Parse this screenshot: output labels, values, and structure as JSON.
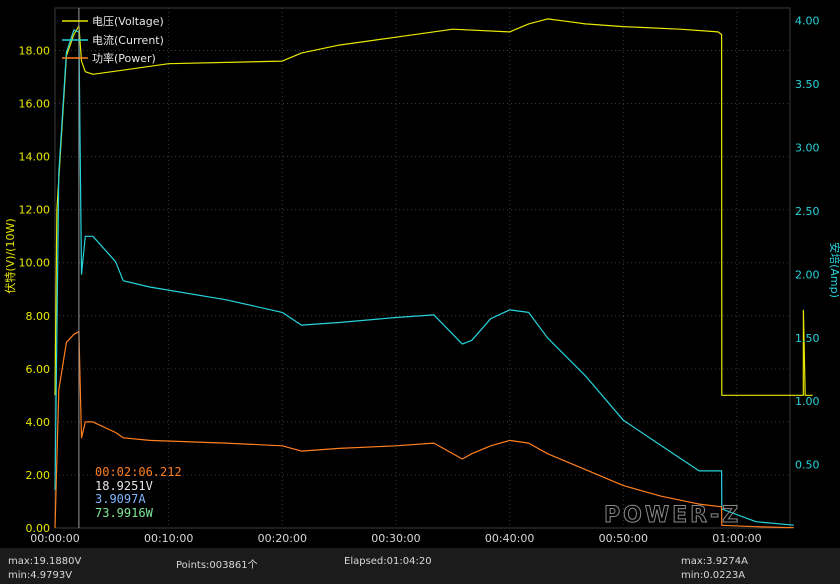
{
  "chart_data": {
    "type": "line",
    "left_axis": {
      "label": "伏特(V)/(10W)",
      "color": "#e8e800",
      "range": [
        0,
        19.6
      ],
      "ticks": [
        "0.00",
        "2.00",
        "4.00",
        "6.00",
        "8.00",
        "10.00",
        "12.00",
        "14.00",
        "16.00",
        "18.00"
      ]
    },
    "right_axis": {
      "label": "安培(Amp)",
      "color": "#27d3dc",
      "range": [
        0,
        4.1
      ],
      "ticks": [
        "0.50",
        "1.00",
        "1.50",
        "2.00",
        "2.50",
        "3.00",
        "3.50",
        "4.00"
      ]
    },
    "x_axis": {
      "range_seconds": [
        0,
        3880
      ],
      "ticks": [
        "00:00:00",
        "00:10:00",
        "00:20:00",
        "00:30:00",
        "00:40:00",
        "00:50:00",
        "01:00:00"
      ]
    },
    "grid": true,
    "legend": {
      "position": "top-left",
      "entries": [
        {
          "name": "电压(Voltage)",
          "color": "#e8e800"
        },
        {
          "name": "电流(Current)",
          "color": "#27d3dc"
        },
        {
          "name": "功率(Power)",
          "color": "#ff7f1e"
        }
      ]
    },
    "series": [
      {
        "name": "电压(Voltage)",
        "axis": "left",
        "color": "#e8e800",
        "x_seconds": [
          0,
          10,
          60,
          100,
          126,
          140,
          160,
          200,
          300,
          600,
          1200,
          1300,
          1500,
          1800,
          2100,
          2400,
          2500,
          2600,
          2700,
          2800,
          3000,
          3300,
          3500,
          3519,
          3520,
          3900,
          3950,
          3951,
          3960,
          3961,
          4000
        ],
        "values": [
          5.0,
          12.0,
          17.8,
          18.6,
          18.925,
          17.6,
          17.2,
          17.1,
          17.2,
          17.5,
          17.6,
          17.9,
          18.2,
          18.5,
          18.8,
          18.7,
          19.0,
          19.188,
          19.1,
          19.0,
          18.9,
          18.8,
          18.7,
          18.6,
          5.0,
          5.0,
          5.0,
          8.2,
          5.0,
          5.0,
          5.0
        ]
      },
      {
        "name": "电流(Current)",
        "axis": "right",
        "color": "#27d3dc",
        "x_seconds": [
          0,
          20,
          60,
          100,
          126,
          140,
          160,
          200,
          320,
          360,
          500,
          900,
          1200,
          1300,
          1500,
          1800,
          2000,
          2150,
          2200,
          2300,
          2400,
          2500,
          2600,
          2800,
          3000,
          3200,
          3400,
          3519,
          3520,
          3700,
          3900
        ],
        "values": [
          0.3,
          2.8,
          3.75,
          3.9274,
          3.9097,
          2.0,
          2.3,
          2.3,
          2.1,
          1.95,
          1.9,
          1.8,
          1.7,
          1.6,
          1.62,
          1.66,
          1.68,
          1.45,
          1.48,
          1.65,
          1.72,
          1.7,
          1.5,
          1.2,
          0.85,
          0.65,
          0.45,
          0.45,
          0.15,
          0.05,
          0.0223
        ]
      },
      {
        "name": "功率(Power)",
        "axis": "left",
        "color": "#ff7f1e",
        "x_seconds": [
          0,
          20,
          60,
          100,
          126,
          140,
          160,
          200,
          320,
          360,
          500,
          900,
          1200,
          1300,
          1500,
          1800,
          2000,
          2150,
          2200,
          2300,
          2400,
          2500,
          2600,
          2800,
          3000,
          3200,
          3400,
          3519,
          3520,
          3700,
          3900
        ],
        "values": [
          0.0,
          5.2,
          7.0,
          7.3,
          7.39916,
          3.4,
          4.0,
          4.0,
          3.6,
          3.4,
          3.3,
          3.2,
          3.1,
          2.9,
          3.0,
          3.1,
          3.2,
          2.6,
          2.8,
          3.1,
          3.3,
          3.2,
          2.8,
          2.2,
          1.6,
          1.2,
          0.9,
          0.8,
          0.1,
          0.05,
          0.01
        ]
      }
    ],
    "cursor": {
      "time": "00:02:06.212",
      "voltage": "18.9251V",
      "current": "3.9097A",
      "power": "73.9916W"
    },
    "brand": "POWER-Z"
  },
  "status": {
    "vmax": "max:19.1880V",
    "vmin": "min:4.9793V",
    "points": "Points:003861个",
    "elapsed": "Elapsed:01:04:20",
    "amax": "max:3.9274A",
    "amin": "min:0.0223A"
  }
}
